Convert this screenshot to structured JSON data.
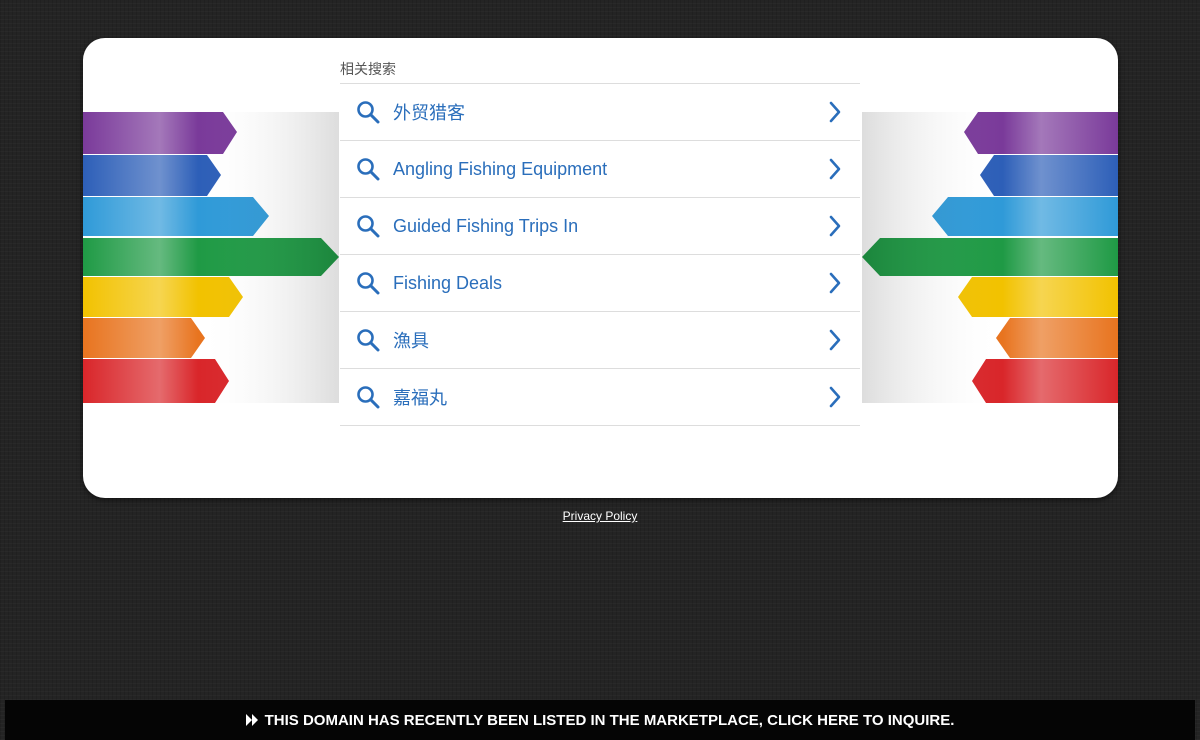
{
  "card": {
    "heading": "相关搜索",
    "results": [
      {
        "label": "外贸猎客"
      },
      {
        "label": "Angling Fishing Equipment"
      },
      {
        "label": "Guided Fishing Trips In"
      },
      {
        "label": "Fishing Deals"
      },
      {
        "label": "漁具"
      },
      {
        "label": "嘉福丸"
      }
    ],
    "ribbon_colors": [
      "#7a3a9a",
      "#2d5fb8",
      "#2f9ad8",
      "#1f9a45",
      "#f2c200",
      "#e8741f",
      "#d9262a"
    ]
  },
  "footer": {
    "privacy_label": "Privacy Policy",
    "banner_text": "THIS DOMAIN HAS RECENTLY BEEN LISTED IN THE MARKETPLACE, CLICK HERE TO INQUIRE."
  },
  "colors": {
    "accent": "#2a6ebb",
    "background": "#242424"
  }
}
